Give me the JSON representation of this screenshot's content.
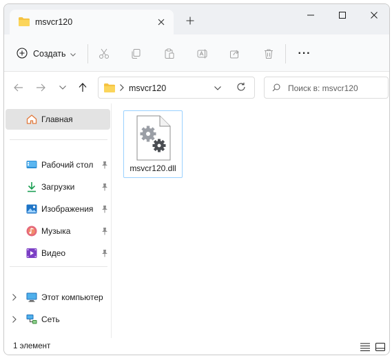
{
  "window": {
    "tab_title": "msvcr120",
    "new_tab_symbol": "+"
  },
  "toolbar": {
    "create_label": "Создать",
    "more_label": "···"
  },
  "address": {
    "path": "msvcr120",
    "search_placeholder": "Поиск в: msvcr120"
  },
  "sidebar": {
    "home": "Главная",
    "pinned": [
      {
        "label": "Рабочий стол",
        "icon": "desktop-icon"
      },
      {
        "label": "Загрузки",
        "icon": "downloads-icon"
      },
      {
        "label": "Изображения",
        "icon": "pictures-icon"
      },
      {
        "label": "Музыка",
        "icon": "music-icon"
      },
      {
        "label": "Видео",
        "icon": "videos-icon"
      }
    ],
    "locations": [
      {
        "label": "Этот компьютер",
        "icon": "this-pc-icon"
      },
      {
        "label": "Сеть",
        "icon": "network-icon"
      }
    ]
  },
  "files": [
    {
      "name": "msvcr120.dll",
      "icon": "dll-file-icon"
    }
  ],
  "status": {
    "item_count": "1 элемент"
  },
  "colors": {
    "titlebar_bg": "#eef0f3",
    "selection_border": "#99d1ff",
    "folder_yellow": "#f5c342"
  }
}
